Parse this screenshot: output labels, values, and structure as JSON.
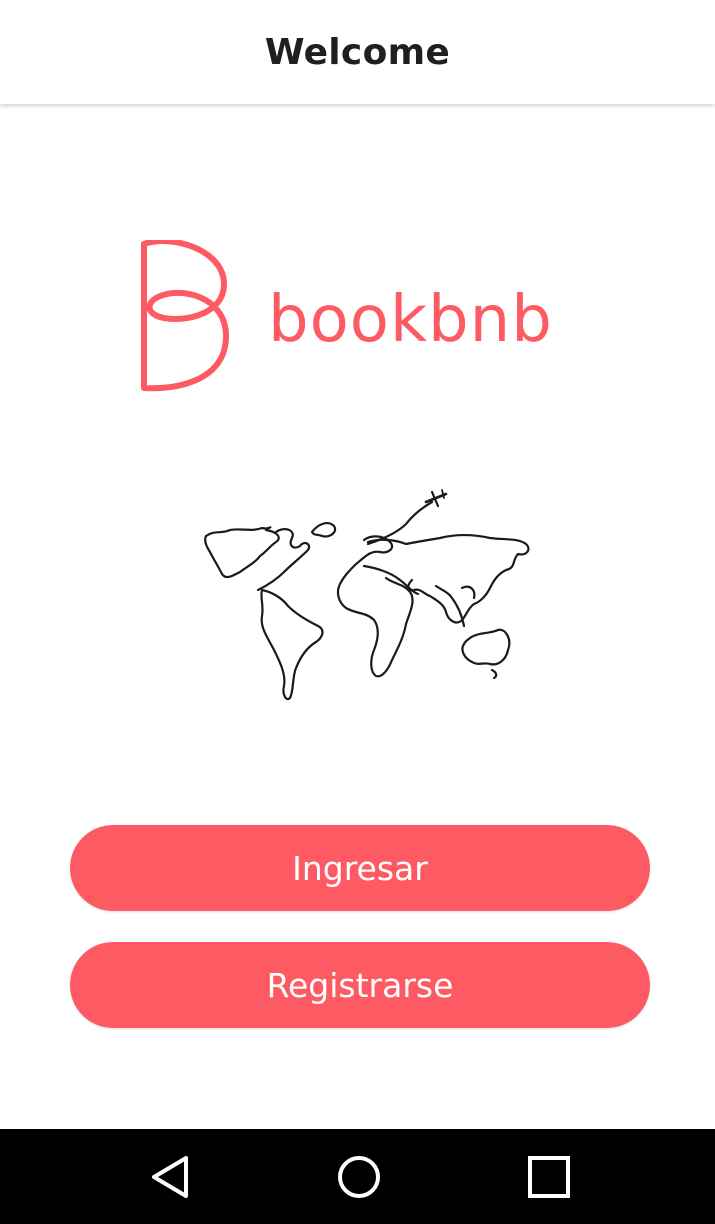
{
  "app_bar": {
    "title": "Welcome"
  },
  "logo": {
    "text": "bookbnb",
    "mark_icon": "letter-b-logo-icon",
    "color": "#fe5a64"
  },
  "illustration": {
    "icon": "world-map-airplane-icon"
  },
  "buttons": {
    "login_label": "Ingresar",
    "register_label": "Registrarse",
    "color": "#fe5a64",
    "text_color": "#ffffff"
  },
  "nav_bar": {
    "back_icon": "back-triangle-icon",
    "home_icon": "home-circle-icon",
    "recents_icon": "recents-square-icon"
  }
}
